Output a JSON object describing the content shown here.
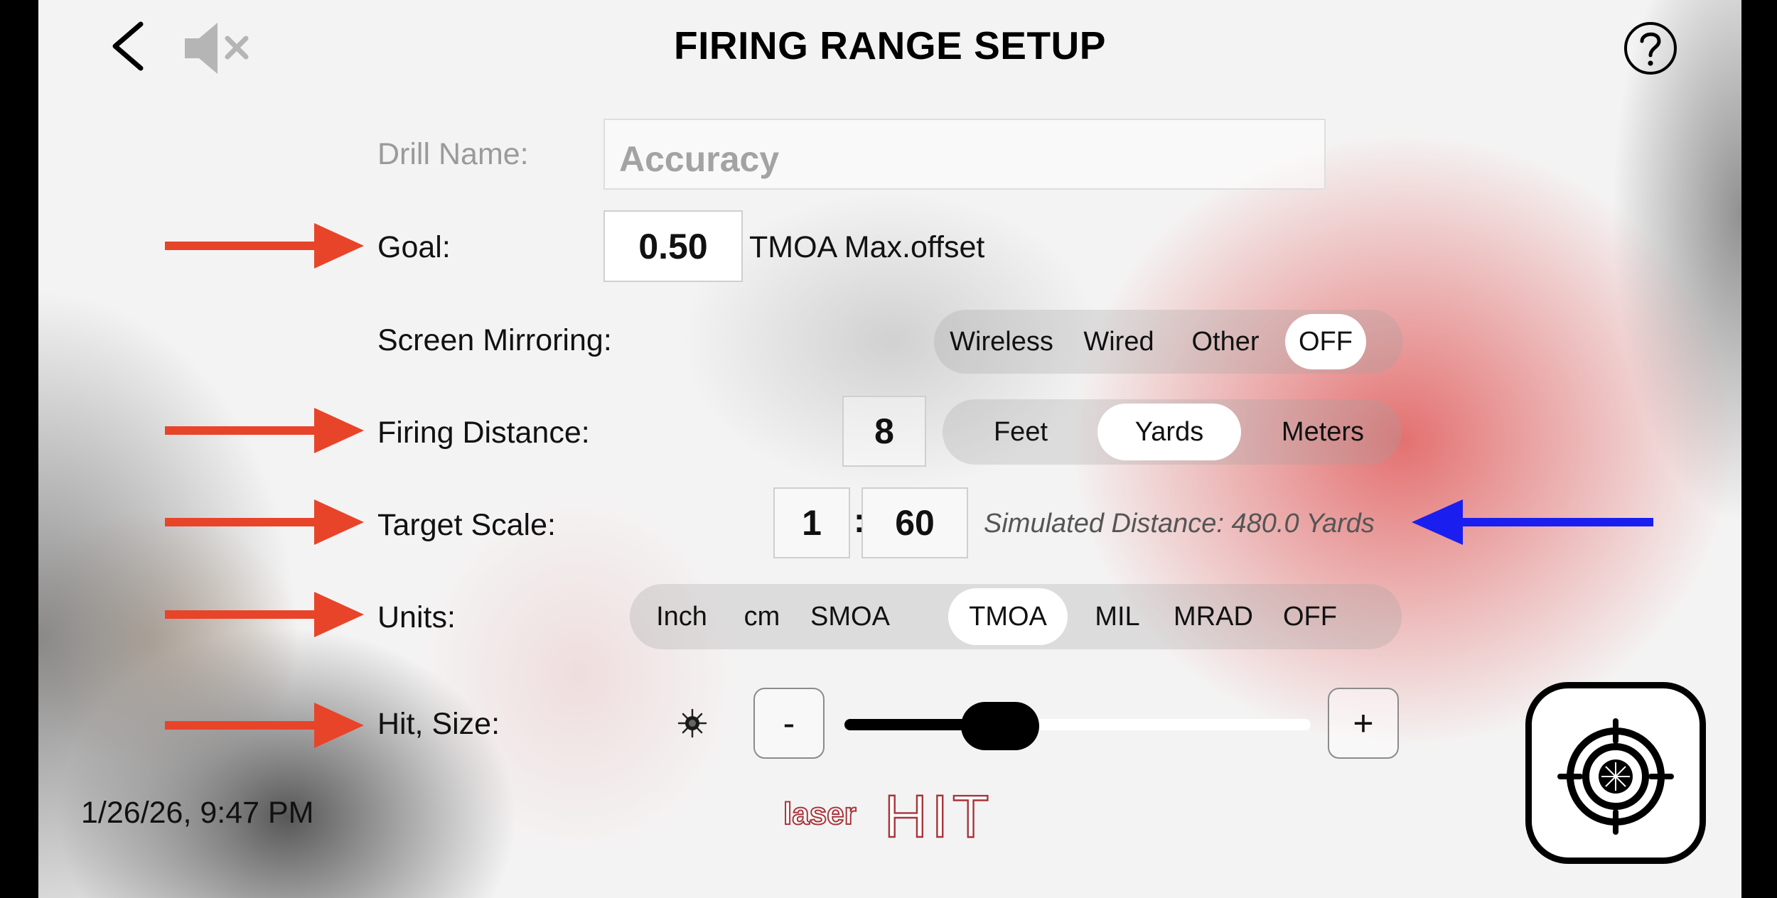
{
  "header": {
    "title": "FIRING RANGE SETUP",
    "back_icon": "chevron-left-icon",
    "mute_icon": "speaker-muted-icon",
    "help_icon": "question-circle-icon"
  },
  "drill": {
    "label": "Drill Name:",
    "value": "Accuracy"
  },
  "goal": {
    "label": "Goal:",
    "value": "0.50",
    "suffix": "TMOA Max.offset"
  },
  "mirroring": {
    "label": "Screen Mirroring:",
    "options": [
      "Wireless",
      "Wired",
      "Other",
      "OFF"
    ],
    "selected": "OFF"
  },
  "distance": {
    "label": "Firing Distance:",
    "value": "8",
    "options": [
      "Feet",
      "Yards",
      "Meters"
    ],
    "selected": "Yards"
  },
  "scale": {
    "label": "Target Scale:",
    "left": "1",
    "separator": ":",
    "right": "60",
    "simulated": "Simulated Distance: 480.0 Yards"
  },
  "units": {
    "label": "Units:",
    "options": [
      "Inch",
      "cm",
      "SMOA",
      "TMOA",
      "MIL",
      "MRAD",
      "OFF"
    ],
    "selected": "TMOA"
  },
  "hit_size": {
    "label": "Hit, Size:",
    "minus": "-",
    "plus": "+",
    "level": 0.3
  },
  "footer": {
    "timestamp": "1/26/26, 9:47 PM",
    "logo_text_small": "laser",
    "logo_text_big": "HIT"
  },
  "colors": {
    "red_arrow": "#e8442a",
    "blue_arrow": "#1a1ff0",
    "logo": "#a8343a"
  }
}
